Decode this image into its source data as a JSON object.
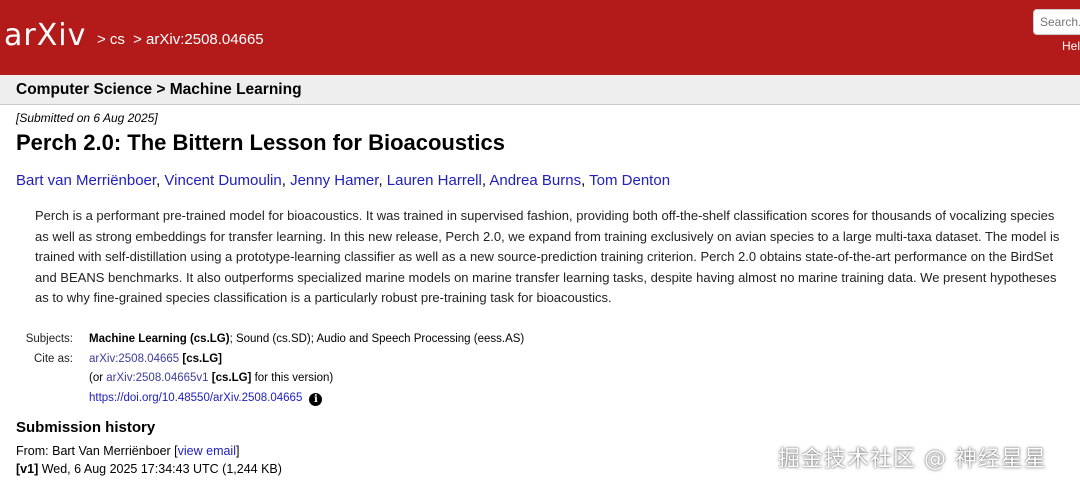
{
  "header": {
    "logo": "arXiv",
    "breadcrumb": [
      "> cs",
      "> arXiv:2508.04665"
    ],
    "search_placeholder": "Search...",
    "help_label": "Help"
  },
  "subheader": {
    "text": "Computer Science > Machine Learning"
  },
  "submitted": "[Submitted on 6 Aug 2025]",
  "title": "Perch 2.0: The Bittern Lesson for Bioacoustics",
  "authors": [
    "Bart van Merriënboer",
    "Vincent Dumoulin",
    "Jenny Hamer",
    "Lauren Harrell",
    "Andrea Burns",
    "Tom Denton"
  ],
  "author_sep": ", ",
  "abstract": {
    "lines": [
      "Perch is a performant pre-trained model for bioacoustics. It was trained in supervised fashion, providing both off-the-shelf classification scores for thousands of vocalizing species",
      "as well as strong embeddings for transfer learning. In this new release, Perch 2.0, we expand from training exclusively on avian species to a large multi-taxa dataset. The model is",
      "trained with self-distillation using a prototype-learning classifier as well as a new source-prediction training criterion. Perch 2.0 obtains state-of-the-art performance on the BirdSet",
      "and BEANS benchmarks. It also outperforms specialized marine models on marine transfer learning tasks, despite having almost no marine training data. We present hypotheses",
      "as to why fine-grained species classification is a particularly robust pre-training task for bioacoustics."
    ]
  },
  "metadata": {
    "subjects_label": "Subjects:",
    "subjects_primary": "Machine Learning (cs.LG)",
    "subjects_rest": "; Sound (cs.SD); Audio and Speech Processing (eess.AS)",
    "cite_label": "Cite as:",
    "cite_id": "arXiv:2508.04665",
    "cite_class": "[cs.LG]",
    "version_prefix": "(or ",
    "version_id": "arXiv:2508.04665v1",
    "version_class": "[cs.LG]",
    "version_suffix": " for this version)",
    "doi": "https://doi.org/10.48550/arXiv.2508.04665",
    "info_icon": "i"
  },
  "history": {
    "heading": "Submission history",
    "from_prefix": "From: Bart Van Merriënboer [",
    "view_email": "view email",
    "from_suffix": "]",
    "v1_label": "[v1]",
    "v1_text": " Wed, 6 Aug 2025 17:34:43 UTC (1,244 KB)"
  },
  "watermark": "掘金技术社区 @ 神经星星"
}
